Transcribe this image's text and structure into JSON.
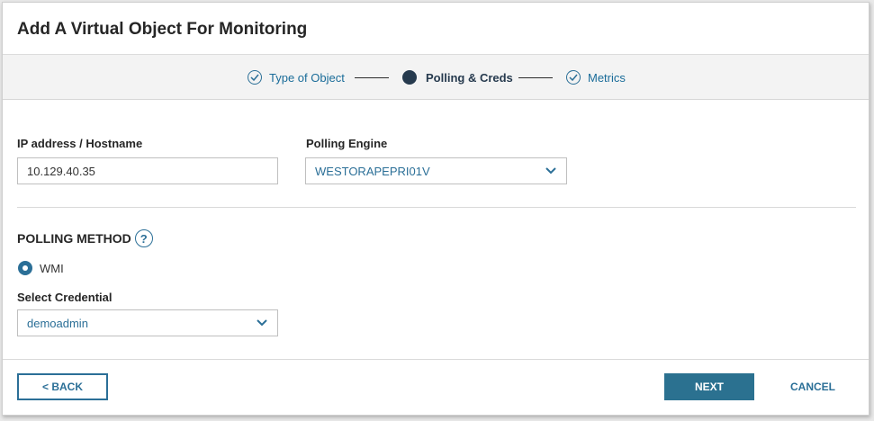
{
  "dialog": {
    "title": "Add A Virtual Object For Monitoring"
  },
  "wizard": {
    "steps": [
      {
        "label": "Type of Object",
        "state": "completed"
      },
      {
        "label": "Polling & Creds",
        "state": "active"
      },
      {
        "label": "Metrics",
        "state": "completed"
      }
    ]
  },
  "form": {
    "ip_label": "IP address / Hostname",
    "ip_value": "10.129.40.35",
    "engine_label": "Polling Engine",
    "engine_value": "WESTORAPEPRI01V",
    "polling_method_title": "POLLING METHOD",
    "help_glyph": "?",
    "radio_option": "WMI",
    "credential_label": "Select Credential",
    "credential_value": "demoadmin"
  },
  "footer": {
    "back_label": "< BACK",
    "next_label": "NEXT",
    "cancel_label": "CANCEL"
  },
  "colors": {
    "accent": "#2b6f97",
    "active_step": "#263a4e",
    "primary_button": "#2b7190"
  }
}
